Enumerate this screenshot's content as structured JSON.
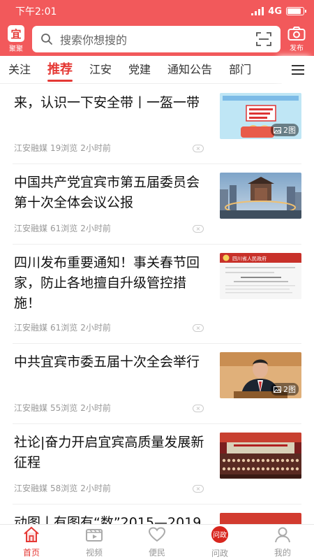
{
  "status": {
    "time": "下午2:01",
    "network": "4G",
    "battery_level": 0.85
  },
  "header": {
    "logo_text": "宜",
    "logo_label": "聚聚",
    "search_placeholder": "搜索你想搜的",
    "publish_label": "发布"
  },
  "tabs": [
    {
      "label": "关注",
      "active": false
    },
    {
      "label": "推荐",
      "active": true
    },
    {
      "label": "江安",
      "active": false
    },
    {
      "label": "党建",
      "active": false
    },
    {
      "label": "通知公告",
      "active": false
    },
    {
      "label": "部门",
      "active": false
    }
  ],
  "feed": [
    {
      "title": "来，认识一下安全带丨一盔一带",
      "source": "江安融媒",
      "views": "19浏览",
      "time": "2小时前",
      "badge": "2图",
      "thumb": "infographic"
    },
    {
      "title": "中国共产党宜宾市第五届委员会第十次全体会议公报",
      "source": "江安融媒",
      "views": "61浏览",
      "time": "2小时前",
      "badge": "",
      "thumb": "city"
    },
    {
      "title": "四川发布重要通知！事关春节回家，防止各地擅自升级管控措施！",
      "source": "江安融媒",
      "views": "61浏览",
      "time": "2小时前",
      "badge": "",
      "thumb": "document",
      "thumb_header": "四川省人民政府"
    },
    {
      "title": "中共宜宾市委五届十次全会举行",
      "source": "江安融媒",
      "views": "55浏览",
      "time": "2小时前",
      "badge": "2图",
      "thumb": "speaker"
    },
    {
      "title": "社论|奋力开启宜宾高质量发展新征程",
      "source": "江安融媒",
      "views": "58浏览",
      "time": "2小时前",
      "badge": "",
      "thumb": "hall"
    },
    {
      "title": "动图丨有图有“数”2015—2019",
      "source": "",
      "views": "",
      "time": "",
      "badge": "",
      "thumb": "red"
    }
  ],
  "bottom_nav": [
    {
      "label": "首页",
      "icon": "home-icon",
      "active": true
    },
    {
      "label": "视频",
      "icon": "video-icon",
      "active": false
    },
    {
      "label": "便民",
      "icon": "heart-icon",
      "active": false
    },
    {
      "label": "问政",
      "icon": "wenzheng-icon",
      "active": false,
      "icon_text": "问政"
    },
    {
      "label": "我的",
      "icon": "user-icon",
      "active": false
    }
  ],
  "colors": {
    "brand": "#f2595b",
    "accent": "#e53935",
    "meta": "#999999"
  }
}
